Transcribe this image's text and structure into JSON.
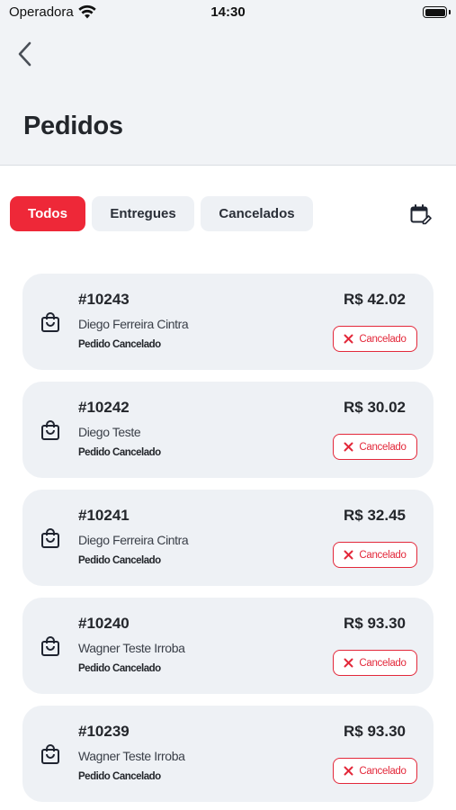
{
  "status_bar": {
    "carrier": "Operadora",
    "time": "14:30"
  },
  "header": {
    "title": "Pedidos"
  },
  "tabs": [
    {
      "label": "Todos",
      "active": true
    },
    {
      "label": "Entregues",
      "active": false
    },
    {
      "label": "Cancelados",
      "active": false
    }
  ],
  "orders": [
    {
      "number": "#10243",
      "customer": "Diego Ferreira Cintra",
      "status": "Pedido Cancelado",
      "price": "R$ 42.02",
      "badge": "Cancelado"
    },
    {
      "number": "#10242",
      "customer": "Diego Teste",
      "status": "Pedido Cancelado",
      "price": "R$ 30.02",
      "badge": "Cancelado"
    },
    {
      "number": "#10241",
      "customer": "Diego Ferreira Cintra",
      "status": "Pedido Cancelado",
      "price": "R$ 32.45",
      "badge": "Cancelado"
    },
    {
      "number": "#10240",
      "customer": "Wagner Teste Irroba",
      "status": "Pedido Cancelado",
      "price": "R$ 93.30",
      "badge": "Cancelado"
    },
    {
      "number": "#10239",
      "customer": "Wagner Teste Irroba",
      "status": "Pedido Cancelado",
      "price": "R$ 93.30",
      "badge": "Cancelado"
    }
  ],
  "colors": {
    "accent": "#ee2838",
    "card_bg": "#eef1f5",
    "header_bg": "#f1f3f6",
    "text": "#23262b"
  },
  "icons": {
    "back": "chevron-left-icon",
    "calendar": "calendar-edit-icon",
    "order": "shopping-bag-icon",
    "badge": "close-icon"
  }
}
